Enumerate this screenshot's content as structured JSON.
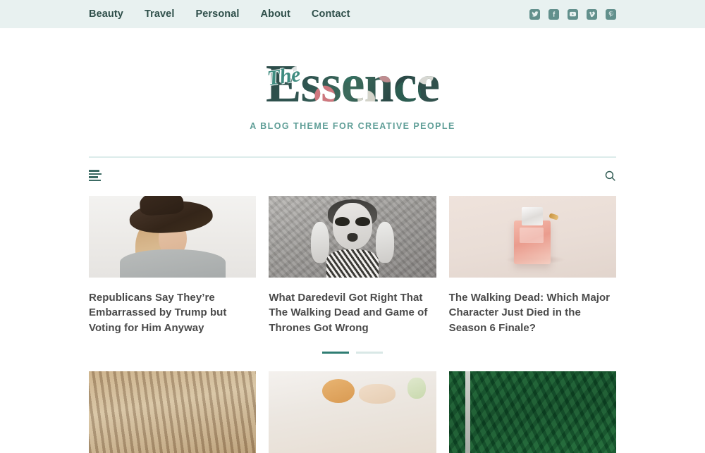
{
  "topbar": {
    "nav": [
      {
        "label": "Beauty"
      },
      {
        "label": "Travel"
      },
      {
        "label": "Personal"
      },
      {
        "label": "About"
      },
      {
        "label": "Contact"
      }
    ],
    "social": [
      {
        "name": "twitter-icon",
        "label": "Twitter"
      },
      {
        "name": "facebook-icon",
        "label": "Facebook"
      },
      {
        "name": "youtube-icon",
        "label": "YouTube"
      },
      {
        "name": "vimeo-icon",
        "label": "Vimeo"
      },
      {
        "name": "pinterest-icon",
        "label": "Pinterest"
      }
    ]
  },
  "masthead": {
    "logo_script": "The",
    "logo_main": "Essence",
    "tagline": "A BLOG THEME FOR CREATIVE PEOPLE"
  },
  "toolbar": {
    "menu_label": "Menu",
    "search_label": "Search"
  },
  "posts": [
    {
      "title": "Republicans Say They’re Embarrassed by Trump but Voting for Him Anyway",
      "image": "woman-in-hat"
    },
    {
      "title": "What Daredevil Got Right That The Walking Dead and Game of Thrones Got Wrong",
      "image": "laughing-woman-bw"
    },
    {
      "title": "The Walking Dead: Which Major Character Just Died in the Season 6 Finale?",
      "image": "pink-perfume-bottle"
    }
  ],
  "pagination": {
    "items": [
      {
        "active": true
      },
      {
        "active": false
      }
    ]
  },
  "posts_row2": [
    {
      "image": "brown-texture"
    },
    {
      "image": "cream-food"
    },
    {
      "image": "green-foliage"
    }
  ],
  "colors": {
    "topbar_bg": "#e8f1f0",
    "nav_text": "#2f4f4a",
    "tagline": "#5f9e97",
    "accent": "#2f7d73",
    "rule": "#dceceb",
    "title_text": "#4a4a4a",
    "social_icon": "#62908c"
  }
}
